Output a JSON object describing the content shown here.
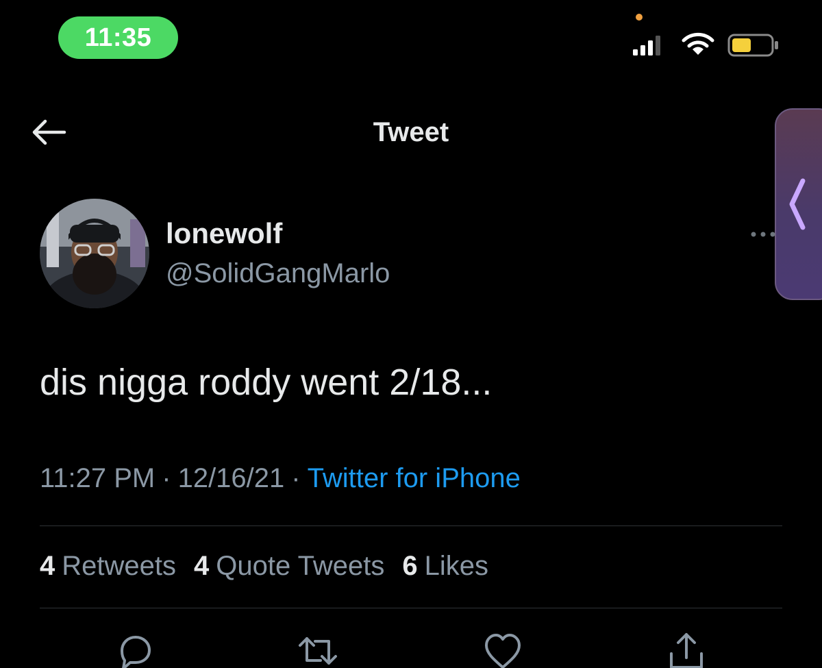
{
  "status_bar": {
    "time": "11:35",
    "colors": {
      "pill": "#4cd964",
      "battery_fill": "#f5d03c",
      "privacy_dot": "#f0a040"
    }
  },
  "header": {
    "title": "Tweet",
    "back_icon": "arrow-left-icon"
  },
  "tweet": {
    "author": {
      "display_name": "lonewolf",
      "handle": "@SolidGangMarlo",
      "avatar_icon": "avatar-photo"
    },
    "text": "dis nigga roddy went 2/18...",
    "meta": {
      "time": "11:27 PM",
      "separator": "·",
      "date": "12/16/21",
      "source": "Twitter for iPhone"
    },
    "stats": {
      "retweets": {
        "count": "4",
        "label": "Retweets"
      },
      "quote_tweets": {
        "count": "4",
        "label": "Quote Tweets"
      },
      "likes": {
        "count": "6",
        "label": "Likes"
      }
    },
    "actions": [
      "reply-icon",
      "retweet-icon",
      "like-icon",
      "share-icon"
    ]
  },
  "theme": {
    "background": "#000000",
    "primary_text": "#e7e9ea",
    "secondary_text": "#8b98a5",
    "link": "#1d9bf0",
    "divider": "#2f3336"
  }
}
